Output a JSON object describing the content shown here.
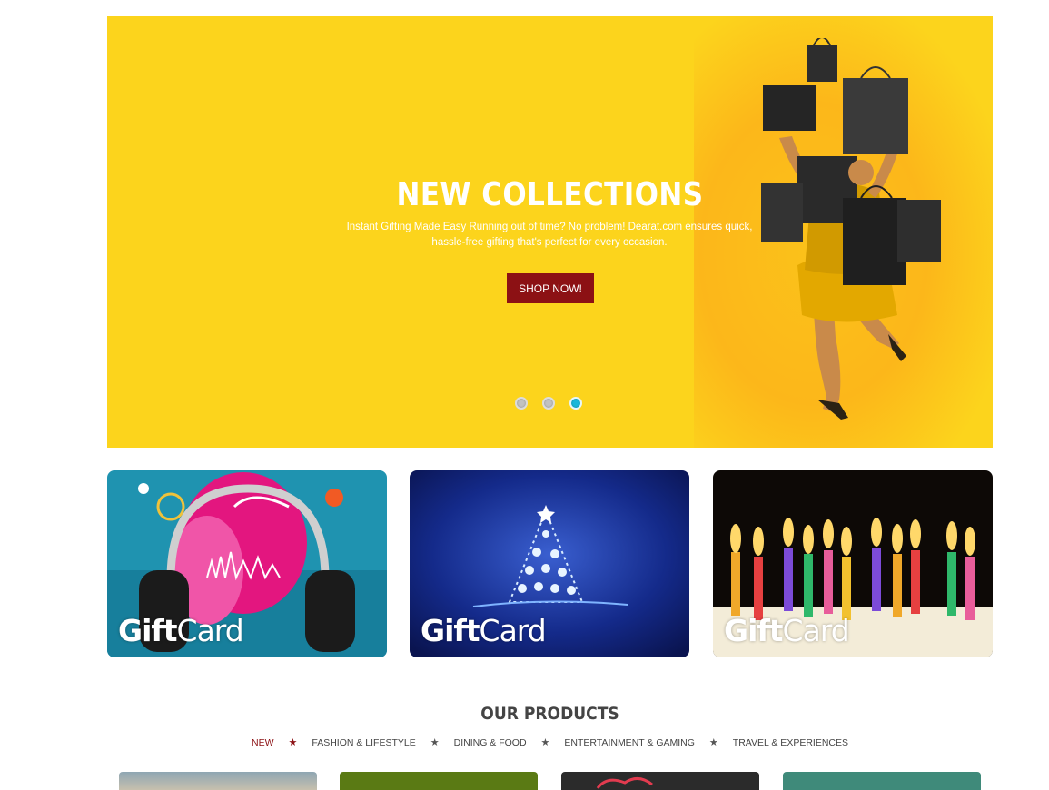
{
  "hero": {
    "title": "NEW COLLECTIONS",
    "subtitle": "Instant Gifting Made Easy Running out of time? No problem! Dearat.com ensures quick, hassle-free gifting that's perfect for every occasion.",
    "button_label": "SHOP NOW!",
    "slide_count": 3,
    "active_slide": 3,
    "colors": {
      "background": "#fcd41c",
      "button": "#8c1114",
      "active_dot": "#1ab7d9"
    }
  },
  "gift_cards": [
    {
      "name": "music",
      "label_bold": "Gift",
      "label_light": "Card"
    },
    {
      "name": "christmas",
      "label_bold": "Gift",
      "label_light": "Card"
    },
    {
      "name": "birthday",
      "label_bold": "Gift",
      "label_light": "Card"
    }
  ],
  "products": {
    "title": "OUR PRODUCTS",
    "tabs": [
      {
        "label": "NEW",
        "active": true
      },
      {
        "label": "FASHION & LIFESTYLE",
        "active": false
      },
      {
        "label": "DINING & FOOD",
        "active": false
      },
      {
        "label": "ENTERTAINMENT & GAMING",
        "active": false
      },
      {
        "label": "TRAVEL & EXPERIENCES",
        "active": false
      }
    ]
  }
}
